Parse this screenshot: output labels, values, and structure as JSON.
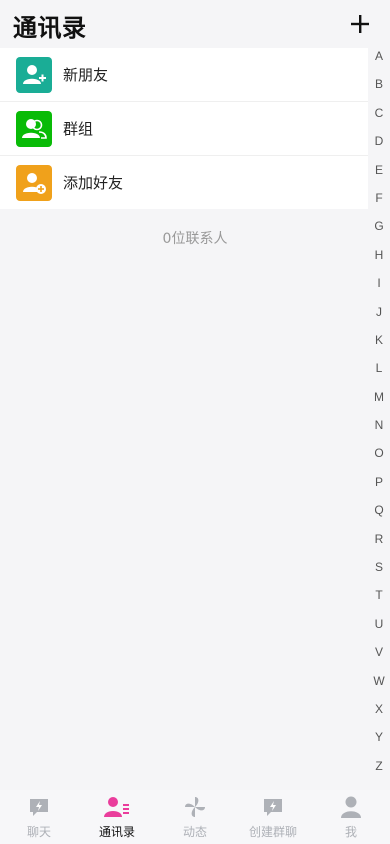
{
  "header": {
    "title": "通讯录"
  },
  "items": [
    {
      "label": "新朋友",
      "color": "#1aad96",
      "icon": "user-add-icon"
    },
    {
      "label": "群组",
      "color": "#09bb07",
      "icon": "group-icon"
    },
    {
      "label": "添加好友",
      "color": "#f0a11b",
      "icon": "user-plus-circle-icon"
    }
  ],
  "contact_count": "0位联系人",
  "index_letters": [
    "A",
    "B",
    "C",
    "D",
    "E",
    "F",
    "G",
    "H",
    "I",
    "J",
    "K",
    "L",
    "M",
    "N",
    "O",
    "P",
    "Q",
    "R",
    "S",
    "T",
    "U",
    "V",
    "W",
    "X",
    "Y",
    "Z"
  ],
  "tabbar": {
    "chat": "聊天",
    "contacts": "通讯录",
    "moments": "动态",
    "create_group": "创建群聊",
    "me": "我",
    "active_color": "#ea3d9c",
    "inactive_color": "#aeb1b7"
  }
}
